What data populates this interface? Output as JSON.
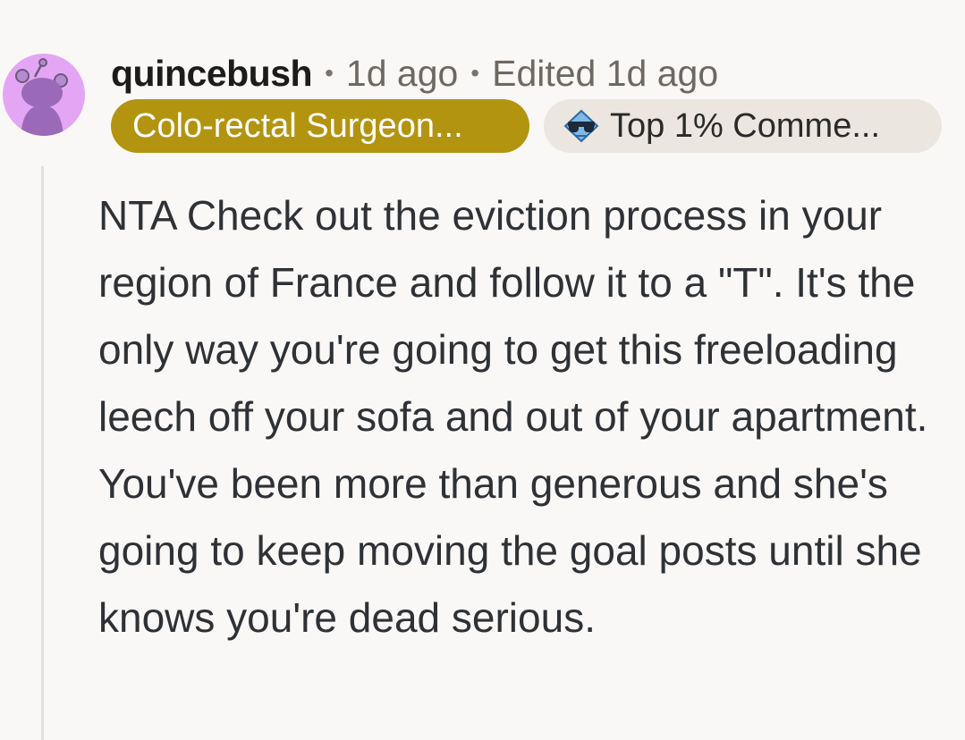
{
  "comment": {
    "username": "quincebush",
    "separator": "•",
    "time_ago": "1d ago",
    "edited": "Edited 1d ago",
    "flairs": {
      "user_flair": "Colo-rectal Surgeon...",
      "achievement_flair": "Top 1% Comme...",
      "achievement_icon": "sunglasses-badge-icon"
    },
    "body": "NTA Check out the eviction process in your region of France and follow it to a \"T\". It's the only way you're going to get this freeloading leech off your sofa and out of your apartment. You've been more than generous and she's going to keep moving the goal posts until she knows you're dead serious."
  },
  "colors": {
    "avatar_background": "#e4a6f4",
    "user_flair_background": "#b39410",
    "achievement_flair_background": "#ebe6e0",
    "page_background": "#faf8f6"
  }
}
